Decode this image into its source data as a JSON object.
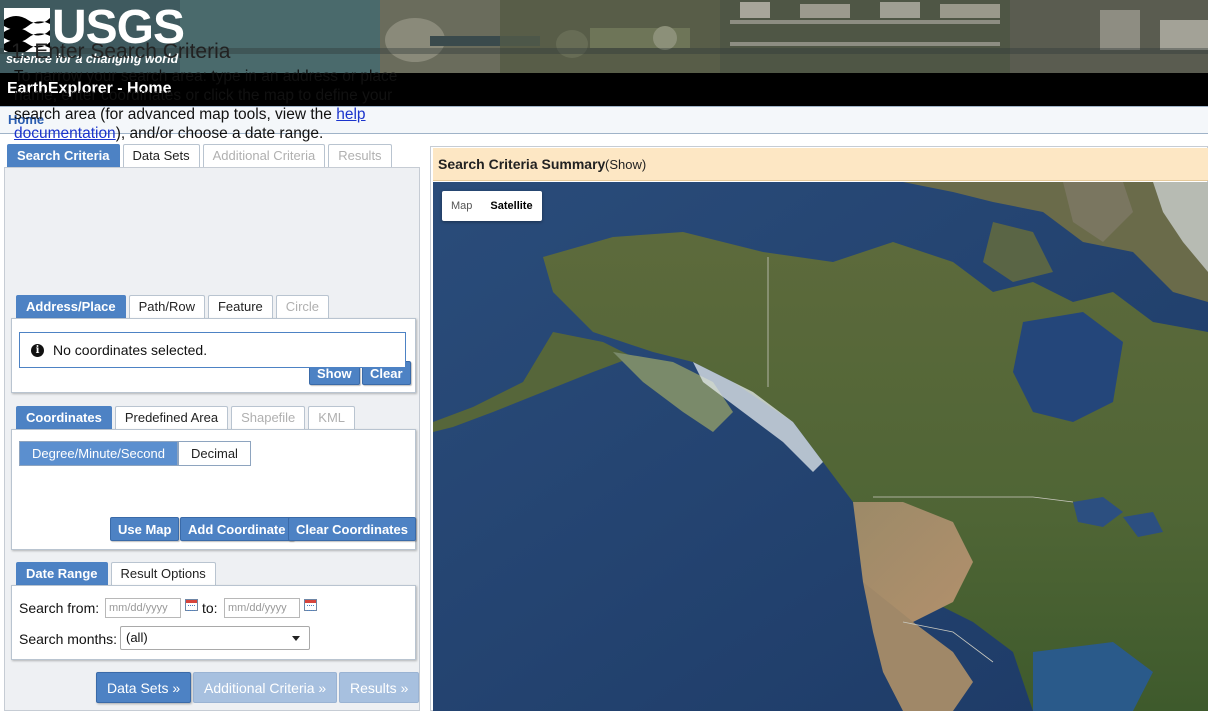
{
  "header": {
    "logo_text": "USGS",
    "logo_tagline": "science for a changing world",
    "app_title": "EarthExplorer - Home"
  },
  "breadcrumb": {
    "home": "Home"
  },
  "main_tabs": [
    {
      "label": "Search Criteria",
      "state": "active"
    },
    {
      "label": "Data Sets",
      "state": "normal"
    },
    {
      "label": "Additional Criteria",
      "state": "disabled"
    },
    {
      "label": "Results",
      "state": "disabled"
    }
  ],
  "search": {
    "step_title": "1. Enter Search Criteria",
    "intro_before": "To narrow your search area: type in an address or place name, enter coordinates or click the map to define your search area (for advanced map tools, view the ",
    "intro_link": "help documentation",
    "intro_after": "), and/or choose a date range."
  },
  "area_tabs": [
    {
      "label": "Address/Place",
      "state": "active"
    },
    {
      "label": "Path/Row",
      "state": "normal"
    },
    {
      "label": "Feature",
      "state": "normal"
    },
    {
      "label": "Circle",
      "state": "disabled"
    }
  ],
  "address": {
    "value": "",
    "show_button": "Show",
    "clear_button": "Clear"
  },
  "coord_tabs": [
    {
      "label": "Coordinates",
      "state": "active"
    },
    {
      "label": "Predefined Area",
      "state": "normal"
    },
    {
      "label": "Shapefile",
      "state": "disabled"
    },
    {
      "label": "KML",
      "state": "disabled"
    }
  ],
  "coordinates": {
    "format_options": [
      "Degree/Minute/Second",
      "Decimal"
    ],
    "selected_format": "Degree/Minute/Second",
    "notice": "No coordinates selected.",
    "use_map_button": "Use Map",
    "add_button": "Add Coordinate",
    "clear_button": "Clear Coordinates"
  },
  "date_tabs": [
    {
      "label": "Date Range",
      "state": "active"
    },
    {
      "label": "Result Options",
      "state": "normal"
    }
  ],
  "date_range": {
    "from_label": "Search from:",
    "from_placeholder": "mm/dd/yyyy",
    "to_label": "to:",
    "to_placeholder": "mm/dd/yyyy",
    "months_label": "Search months:",
    "months_value": "(all)"
  },
  "nav_buttons": [
    {
      "label": "Data Sets »",
      "state": "enabled"
    },
    {
      "label": "Additional Criteria »",
      "state": "disabled"
    },
    {
      "label": "Results »",
      "state": "disabled"
    }
  ],
  "map_panel": {
    "summary_title": "Search Criteria Summary",
    "summary_toggle": "(Show)",
    "map_types": [
      "Map",
      "Satellite"
    ],
    "selected_map_type": "Satellite"
  },
  "colors": {
    "accent": "#4d82c4",
    "summary_bg": "#fde7c4",
    "titlebar": "#000000",
    "link": "#1a33cc"
  }
}
